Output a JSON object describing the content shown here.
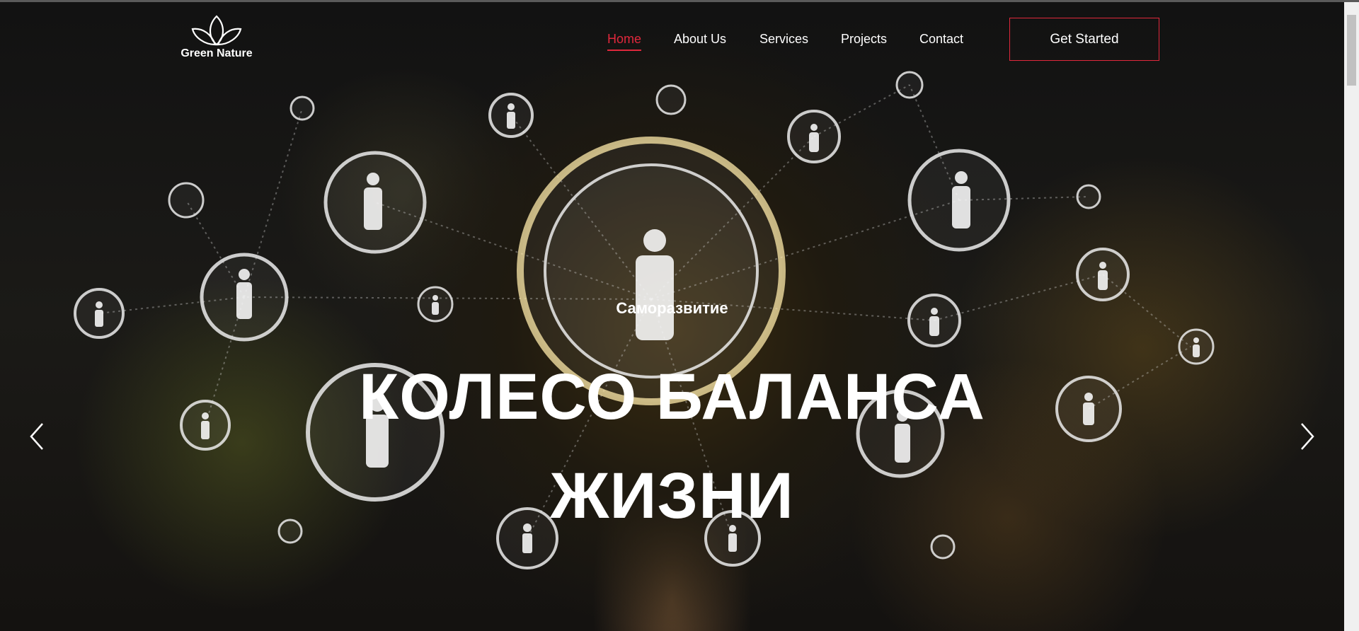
{
  "brand": {
    "name": "Green Nature"
  },
  "nav": {
    "items": [
      {
        "label": "Home",
        "active": true
      },
      {
        "label": "About Us",
        "active": false
      },
      {
        "label": "Services",
        "active": false
      },
      {
        "label": "Projects",
        "active": false
      },
      {
        "label": "Contact",
        "active": false
      }
    ],
    "cta_label": "Get Started"
  },
  "slide": {
    "subtitle": "Саморазвитие",
    "headline_line1": "КОЛЕСО БАЛАНСА",
    "headline_line2": "ЖИЗНИ"
  },
  "controls": {
    "prev_icon": "chevron-left-icon",
    "next_icon": "chevron-right-icon"
  },
  "colors": {
    "accent": "#e0283c",
    "text": "#ffffff"
  }
}
